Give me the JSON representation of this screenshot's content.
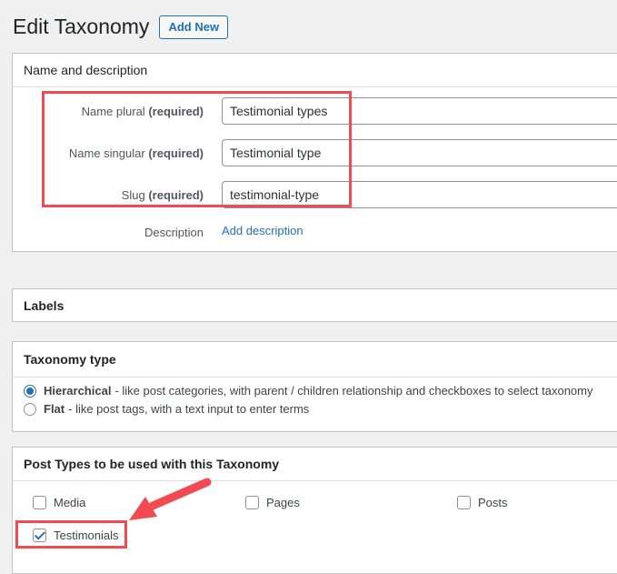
{
  "header": {
    "title": "Edit Taxonomy",
    "add_new_label": "Add New"
  },
  "name_box": {
    "title": "Name and description",
    "fields": [
      {
        "label": "Name plural",
        "required": "(required)",
        "value": "Testimonial types"
      },
      {
        "label": "Name singular",
        "required": "(required)",
        "value": "Testimonial type"
      },
      {
        "label": "Slug",
        "required": "(required)",
        "value": "testimonial-type"
      }
    ],
    "description_label": "Description",
    "description_link": "Add description"
  },
  "labels_box": {
    "title": "Labels"
  },
  "taxonomy_type": {
    "title": "Taxonomy type",
    "options": [
      {
        "name": "Hierarchical",
        "desc": "- like post categories, with parent / children relationship and checkboxes to select taxonomy",
        "selected": true
      },
      {
        "name": "Flat",
        "desc": "- like post tags, with a text input to enter terms",
        "selected": false
      }
    ]
  },
  "post_types": {
    "title": "Post Types to be used with this Taxonomy",
    "items": [
      {
        "label": "Media",
        "checked": false
      },
      {
        "label": "Pages",
        "checked": false
      },
      {
        "label": "Posts",
        "checked": false
      },
      {
        "label": "Testimonials",
        "checked": true
      }
    ]
  },
  "annotation": {
    "color": "#f24a50"
  }
}
